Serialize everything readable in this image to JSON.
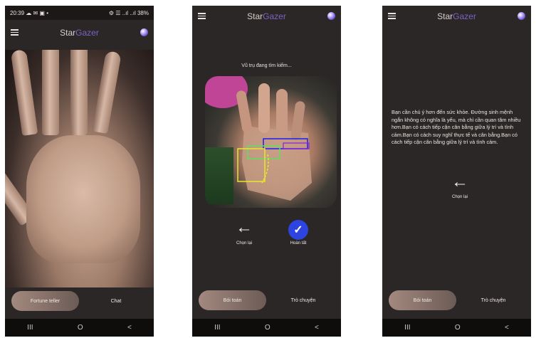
{
  "app": {
    "brand_part1": "Star",
    "brand_part2": "Gazer"
  },
  "screen1": {
    "status": {
      "time": "20:39",
      "left_icons": "☁ ✉ ▣ •",
      "right_icons": "⚙ ☰ ..ıl ..ıl",
      "battery": "38%"
    },
    "tabs": {
      "active": "Fortune teller",
      "other": "Chat"
    },
    "icons": {
      "gallery": "image-icon",
      "shutter": "shutter-button",
      "flip": "camera-flip-icon"
    }
  },
  "screen2": {
    "caption": "Vũ trụ đang tìm kiếm...",
    "back_label": "Chọn lại",
    "done_label": "Hoàn tất",
    "tabs": {
      "active": "Bói toán",
      "other": "Trò chuyện"
    }
  },
  "screen3": {
    "result_text": "Bạn cần chú ý hơn đến sức khỏe. Đường sinh mệnh ngắn không có nghĩa là yếu, mà chỉ cần quan tâm nhiều hơn.Bạn có cách tiếp cận cân bằng giữa lý trí và tình cảm.Bạn có cách suy nghĩ thực tế và cân bằng.Bạn có cách tiếp cận cân bằng giữa lý trí và tình cảm.",
    "back_label": "Chọn lại",
    "tabs": {
      "active": "Bói toán",
      "other": "Trò chuyện"
    }
  },
  "nav": {
    "recents": "III",
    "home": "O",
    "back": "<"
  },
  "colors": {
    "background": "#2b2726",
    "accent": "#7a63c4",
    "pill": "#a3897f",
    "check": "#2d44e0"
  }
}
